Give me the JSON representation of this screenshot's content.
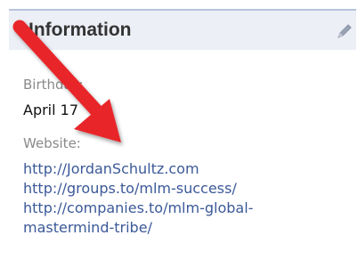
{
  "section": {
    "title": "Information"
  },
  "fields": {
    "birthday": {
      "label": "Birthday:",
      "value": "April 17"
    },
    "website": {
      "label": "Website:",
      "links": [
        "http://JordanSchultz.com",
        "http://groups.to/mlm-success/",
        "http://companies.to/mlm-global-",
        "mastermind-tribe/"
      ]
    }
  },
  "icons": {
    "edit": "pencil-icon",
    "annotation": "arrow-icon"
  },
  "colors": {
    "header_bg": "#eceff5",
    "link": "#3b5998",
    "label": "#8a8a8a",
    "arrow": "#e8262a"
  }
}
